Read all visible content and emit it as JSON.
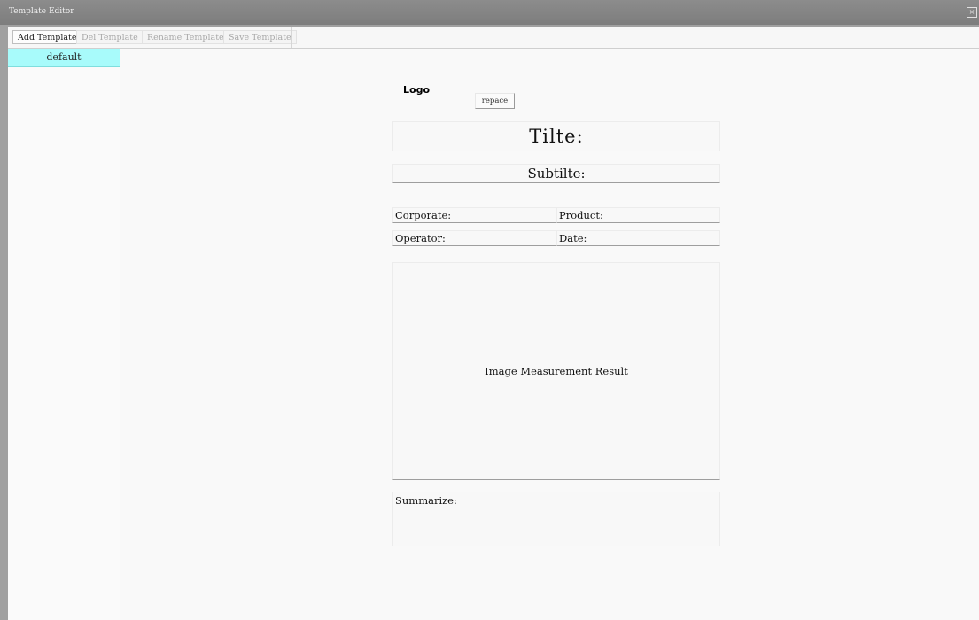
{
  "window": {
    "title": "Template Editor",
    "close_glyph": "×"
  },
  "toolbar": {
    "add_label": "Add Template",
    "del_label": "Del Template",
    "rename_label": "Rename Template",
    "save_label": "Save Template"
  },
  "sidebar": {
    "items": [
      {
        "label": "default",
        "selected": true
      }
    ],
    "selected_color": "#a8fbfb"
  },
  "template": {
    "logo_label": "Logo",
    "replace_label": "repace",
    "title": "Tilte:",
    "subtitle": "Subtilte:",
    "corporate": "Corporate:",
    "product": "Product:",
    "operator": "Operator:",
    "date": "Date:",
    "image_placeholder": "Image Measurement Result",
    "summarize": "Summarize:"
  }
}
